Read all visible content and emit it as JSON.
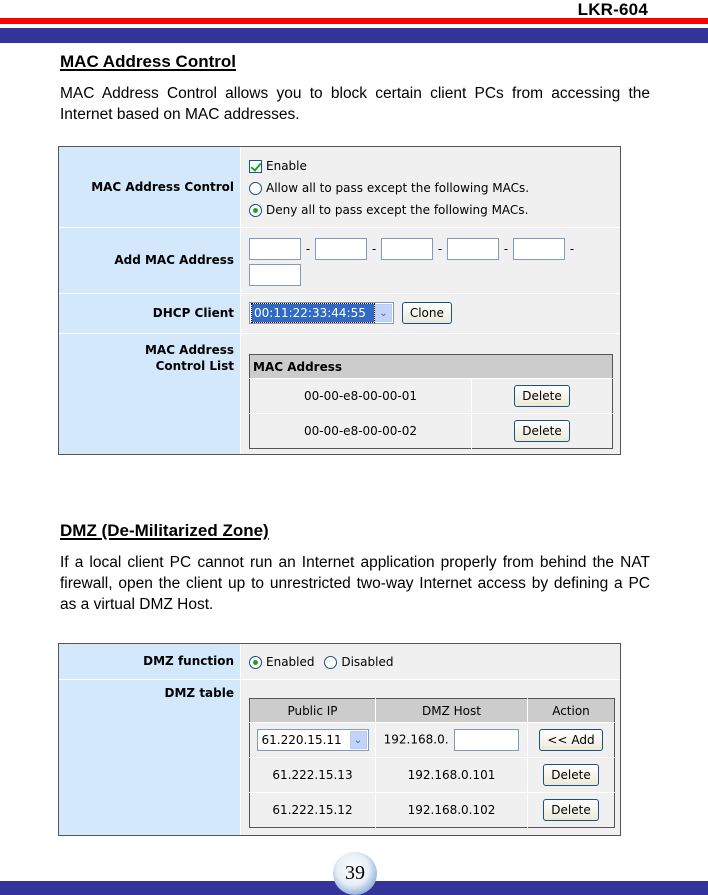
{
  "header": {
    "model": "LKR-604"
  },
  "colors": {
    "red_bar": "#ff0000",
    "blue_bar": "#333399",
    "label_bg": "#d4e8fb",
    "panel_bg": "#f0f0f0",
    "table_header_bg": "#cccccc"
  },
  "mac_section": {
    "title": "MAC Address Control",
    "description": "MAC Address Control allows you to block certain client PCs from accessing the Internet based on MAC addresses.",
    "panel": {
      "mac_control": {
        "label": "MAC Address Control",
        "enable_label": "Enable",
        "enable_checked": true,
        "options": [
          {
            "label": "Allow all to pass except the following MACs.",
            "selected": false
          },
          {
            "label": "Deny all to pass except the following MACs.",
            "selected": true
          }
        ]
      },
      "add_mac": {
        "label": "Add MAC Address",
        "separator": "-",
        "fields": [
          "",
          "",
          "",
          "",
          "",
          ""
        ]
      },
      "dhcp_client": {
        "label": "DHCP Client",
        "selected": "00:11:22:33:44:55",
        "clone_label": "Clone"
      },
      "control_list": {
        "label_line1": "MAC Address",
        "label_line2": "Control List",
        "column_header": "MAC Address",
        "rows": [
          {
            "mac": "00-00-e8-00-00-01",
            "action": "Delete"
          },
          {
            "mac": "00-00-e8-00-00-02",
            "action": "Delete"
          }
        ]
      }
    }
  },
  "dmz_section": {
    "title": "DMZ (De-Militarized Zone)",
    "description": "If a local client PC cannot run an Internet application properly from behind the NAT firewall, open the client up to unrestricted two-way Internet access by defining a PC as a virtual DMZ Host.",
    "panel": {
      "dmz_function": {
        "label": "DMZ function",
        "options": [
          {
            "label": "Enabled",
            "selected": true
          },
          {
            "label": "Disabled",
            "selected": false
          }
        ]
      },
      "dmz_table": {
        "label": "DMZ table",
        "columns": [
          "Public IP",
          "DMZ Host",
          "Action"
        ],
        "input_row": {
          "public_ip": "61.220.15.11",
          "host_prefix": "192.168.0.",
          "host_value": "",
          "action": "<< Add"
        },
        "rows": [
          {
            "public_ip": "61.222.15.13",
            "host": "192.168.0.101",
            "action": "Delete"
          },
          {
            "public_ip": "61.222.15.12",
            "host": "192.168.0.102",
            "action": "Delete"
          }
        ]
      }
    }
  },
  "footer": {
    "page_number": "39"
  }
}
